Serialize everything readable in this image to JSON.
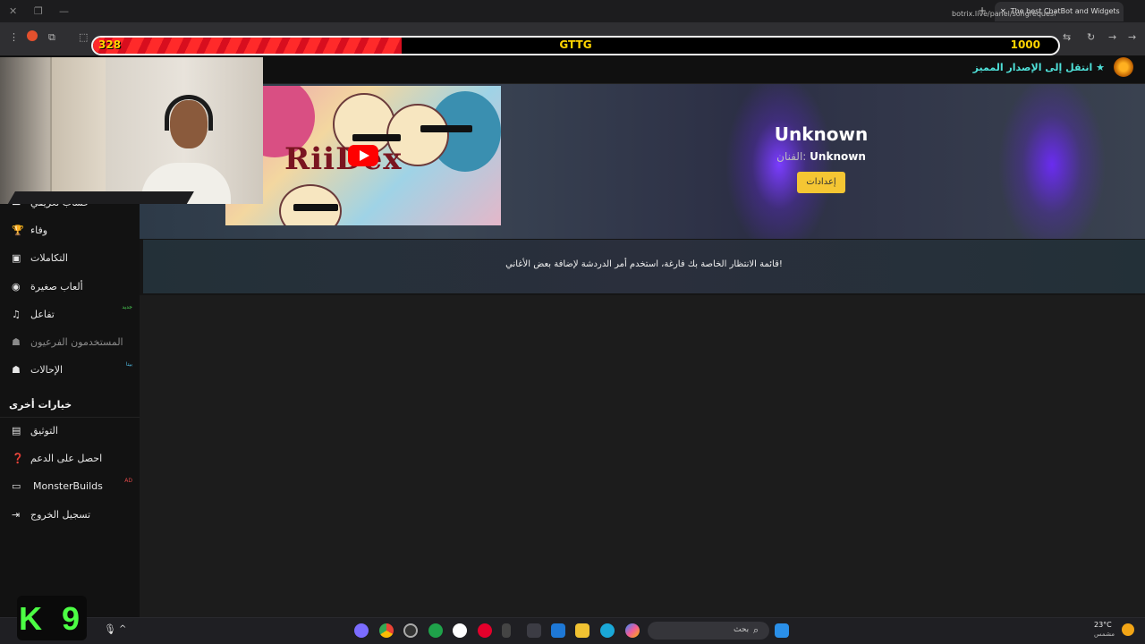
{
  "browser": {
    "active_tab_title": "The best ChatBot and Widgets",
    "url": "botrix.live/panel/songrequest"
  },
  "overlay": {
    "left_value": "328",
    "center_label": "GTTG",
    "right_value": "1000",
    "progress_fraction": 0.32
  },
  "header": {
    "premium_link": "انتقل إلى الإصدار المميز",
    "premium_icon": "star-icon"
  },
  "player": {
    "thumbnail_title": "RiiDex",
    "song_title": "Unknown",
    "artist_label": "الفنان:",
    "artist_name": "Unknown",
    "settings_button": "إعدادات"
  },
  "queue": {
    "empty_message": "قائمة الانتظار الخاصة بك فارغة، استخدم أمر الدردشة لإضافة بعض الأغاني!"
  },
  "sidebar": {
    "items": [
      {
        "label": "حساب تعريفي",
        "icon": "id-card-icon"
      },
      {
        "label": "وفاء",
        "icon": "trophy-icon"
      },
      {
        "label": "التكاملات",
        "icon": "integrations-icon"
      },
      {
        "label": "ألعاب صغيرة",
        "icon": "gamepad-icon"
      },
      {
        "label": "تفاعل",
        "icon": "music-note-icon",
        "badge": "جديد"
      },
      {
        "label": "المستخدمون الفرعيون",
        "icon": "users-icon"
      },
      {
        "label": "الإحالات",
        "icon": "referrals-icon",
        "badge": "بيتا"
      }
    ],
    "section_title": "خيارات أخرى",
    "other_items": [
      {
        "label": "التوثيق",
        "icon": "docs-icon"
      },
      {
        "label": "احصل على الدعم",
        "icon": "question-icon"
      },
      {
        "label": "MonsterBuilds",
        "icon": "laptop-icon",
        "badge": "AD"
      },
      {
        "label": "تسجيل الخروج",
        "icon": "logout-icon"
      }
    ]
  },
  "webcam_badge": "K 9",
  "taskbar": {
    "search_placeholder": "بحث",
    "temperature": "23°C",
    "weather_desc": "مشمس"
  },
  "colors": {
    "accent_yellow": "#f5c633",
    "premium_teal": "#4fe0d8",
    "overlay_red": "#ff2a2a",
    "overlay_text": "#ffd400"
  }
}
